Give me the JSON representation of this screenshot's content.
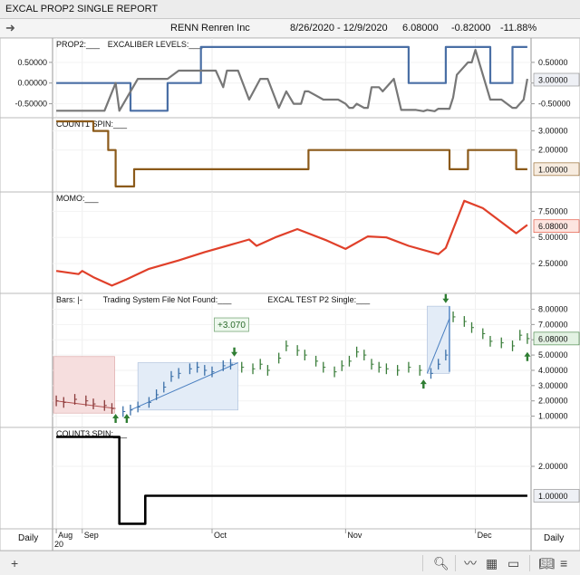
{
  "window": {
    "title": "EXCAL PROP2 SINGLE REPORT"
  },
  "toolbar": {
    "symbol": "RENN",
    "company": "Renren Inc",
    "range": "8/26/2020 - 12/9/2020",
    "last": "6.08000",
    "change": "-0.82000",
    "pct": "-11.88%"
  },
  "footer": {
    "period_left": "Daily",
    "period_right": "Daily",
    "year_label": "20"
  },
  "chart_data": [
    {
      "pane": "prop2",
      "type": "line",
      "labels": [
        "PROP2:___",
        "EXCALIBER LEVELS:___"
      ],
      "yticks": [
        "0.50000",
        "0.00000",
        "-0.50000"
      ],
      "ylim": [
        -0.75,
        1.0
      ],
      "last_value": "3.00000",
      "series": [
        {
          "color": "#4a6fa5",
          "x": [
            1,
            21,
            21,
            31,
            31,
            40,
            40,
            96,
            96,
            106,
            106,
            107,
            107,
            118,
            118,
            124,
            124,
            128
          ],
          "y": [
            0,
            0,
            -0.67,
            -0.67,
            0,
            0,
            0.87,
            0.87,
            0,
            0,
            0.87,
            0.87,
            0.87,
            0.87,
            0,
            0,
            0.87,
            0.87
          ]
        },
        {
          "color": "#777777",
          "x": [
            1,
            14,
            17,
            18,
            23,
            25,
            31,
            34,
            36,
            37,
            44,
            46,
            47,
            50,
            53,
            56,
            58,
            61,
            63,
            65,
            67,
            68,
            69,
            73,
            75,
            77,
            79,
            80,
            81,
            82,
            84,
            85,
            86,
            88,
            89,
            92,
            94,
            98,
            100,
            101,
            103,
            104,
            107,
            108,
            109,
            112,
            113,
            114,
            118,
            119,
            121,
            124,
            125,
            127,
            128
          ],
          "y": [
            -0.67,
            -0.67,
            0,
            -0.67,
            0.1,
            0.1,
            0.1,
            0.3,
            0.3,
            0.3,
            0.3,
            -0.1,
            0.3,
            0.3,
            -0.4,
            0.1,
            0.1,
            -0.6,
            -0.2,
            -0.5,
            -0.5,
            -0.2,
            -0.2,
            -0.4,
            -0.4,
            -0.4,
            -0.5,
            -0.6,
            -0.6,
            -0.5,
            -0.6,
            -0.6,
            -0.1,
            -0.1,
            -0.2,
            0.1,
            -0.65,
            -0.65,
            -0.68,
            -0.65,
            -0.68,
            -0.62,
            -0.62,
            -0.35,
            0.2,
            0.5,
            0.5,
            0.8,
            -0.4,
            -0.4,
            -0.4,
            -0.6,
            -0.6,
            -0.4,
            0.1
          ]
        }
      ]
    },
    {
      "pane": "count1",
      "type": "line",
      "labels": [
        "COUNT1 SPIN:___"
      ],
      "yticks": [
        "3.00000",
        "2.00000"
      ],
      "ylim": [
        0,
        3.5
      ],
      "last_value": "1.00000",
      "series": [
        {
          "color": "#8b5a1a",
          "x": [
            1,
            11,
            11,
            15,
            15,
            17,
            17,
            19,
            19,
            22,
            22,
            69,
            69,
            107,
            107,
            112,
            112,
            113,
            113,
            125,
            125,
            128
          ],
          "y": [
            3.5,
            3.5,
            3.0,
            3.0,
            2.0,
            2.0,
            0.1,
            0.1,
            0.1,
            0.1,
            1.0,
            1.0,
            2.0,
            2.0,
            1.0,
            1.0,
            2.0,
            2.0,
            2.0,
            2.0,
            1.0,
            1.0
          ]
        }
      ]
    },
    {
      "pane": "momo",
      "type": "line",
      "labels": [
        "MOMO:___"
      ],
      "yticks": [
        "7.50000",
        "5.00000",
        "2.50000"
      ],
      "ylim": [
        0,
        9.0
      ],
      "last_value": "6.08000",
      "series": [
        {
          "color": "#e0402a",
          "x": [
            1,
            7,
            8,
            11,
            16,
            20,
            26,
            34,
            41,
            50,
            53,
            55,
            60,
            66,
            74,
            79,
            85,
            90,
            96,
            104,
            106,
            111,
            116,
            125,
            128
          ],
          "y": [
            1.8,
            1.5,
            1.8,
            1.2,
            0.4,
            1.0,
            2.0,
            2.8,
            3.6,
            4.5,
            4.8,
            4.2,
            5.0,
            5.8,
            4.7,
            3.9,
            5.1,
            5.0,
            4.2,
            3.4,
            4.0,
            8.5,
            7.8,
            5.4,
            6.2
          ]
        }
      ]
    },
    {
      "pane": "bars",
      "type": "bar",
      "labels": [
        "Bars: |-",
        "Trading System File Not Found:___",
        "EXCAL TEST P2 Single:___"
      ],
      "yticks": [
        "8.00000",
        "7.00000",
        "6.00000",
        "5.00000",
        "4.00000",
        "3.00000",
        "2.00000",
        "1.00000"
      ],
      "ylim": [
        0.5,
        8.8
      ],
      "last_value": "6.08000",
      "annotation": "+3.070",
      "x": [
        1,
        3,
        6,
        9,
        11,
        14,
        16,
        19,
        21,
        23,
        26,
        28,
        30,
        32,
        34,
        37,
        39,
        41,
        43,
        46,
        48,
        51,
        54,
        56,
        58,
        61,
        63,
        66,
        68,
        71,
        73,
        76,
        78,
        80,
        82,
        84,
        86,
        88,
        90,
        93,
        96,
        99,
        102,
        104,
        106,
        108,
        111,
        113,
        116,
        118,
        121,
        124,
        126,
        128
      ],
      "y": [
        2.0,
        1.9,
        2.1,
        2.0,
        1.8,
        1.7,
        1.5,
        1.3,
        1.4,
        1.6,
        1.9,
        2.4,
        2.9,
        3.6,
        3.8,
        4.1,
        4.2,
        4.0,
        3.9,
        4.3,
        4.4,
        4.2,
        4.1,
        4.4,
        4.0,
        4.8,
        5.6,
        5.3,
        5.0,
        4.6,
        4.2,
        3.9,
        4.3,
        4.6,
        5.2,
        5.0,
        4.4,
        4.2,
        4.1,
        4.0,
        4.2,
        4.0,
        3.8,
        4.4,
        5.0,
        7.5,
        7.2,
        6.8,
        6.4,
        5.9,
        5.8,
        5.6,
        6.3,
        6.08
      ]
    },
    {
      "pane": "count3",
      "type": "line",
      "labels": [
        "COUNT3 SPIN:___"
      ],
      "yticks": [
        "2.00000"
      ],
      "ylim": [
        0,
        3.2
      ],
      "last_value": "1.00000",
      "series": [
        {
          "color": "#000000",
          "x": [
            1,
            15,
            15,
            18,
            18,
            22,
            22,
            25,
            25,
            128
          ],
          "y": [
            3.0,
            3.0,
            3.0,
            3.0,
            0.05,
            0.05,
            0.05,
            0.05,
            1.0,
            1.0
          ]
        }
      ]
    }
  ],
  "xaxis": {
    "labels": [
      "Aug",
      "Sep",
      "Oct",
      "Nov",
      "Dec"
    ],
    "positions": [
      1,
      8,
      43,
      79,
      114
    ],
    "xlim": [
      0,
      129
    ]
  }
}
